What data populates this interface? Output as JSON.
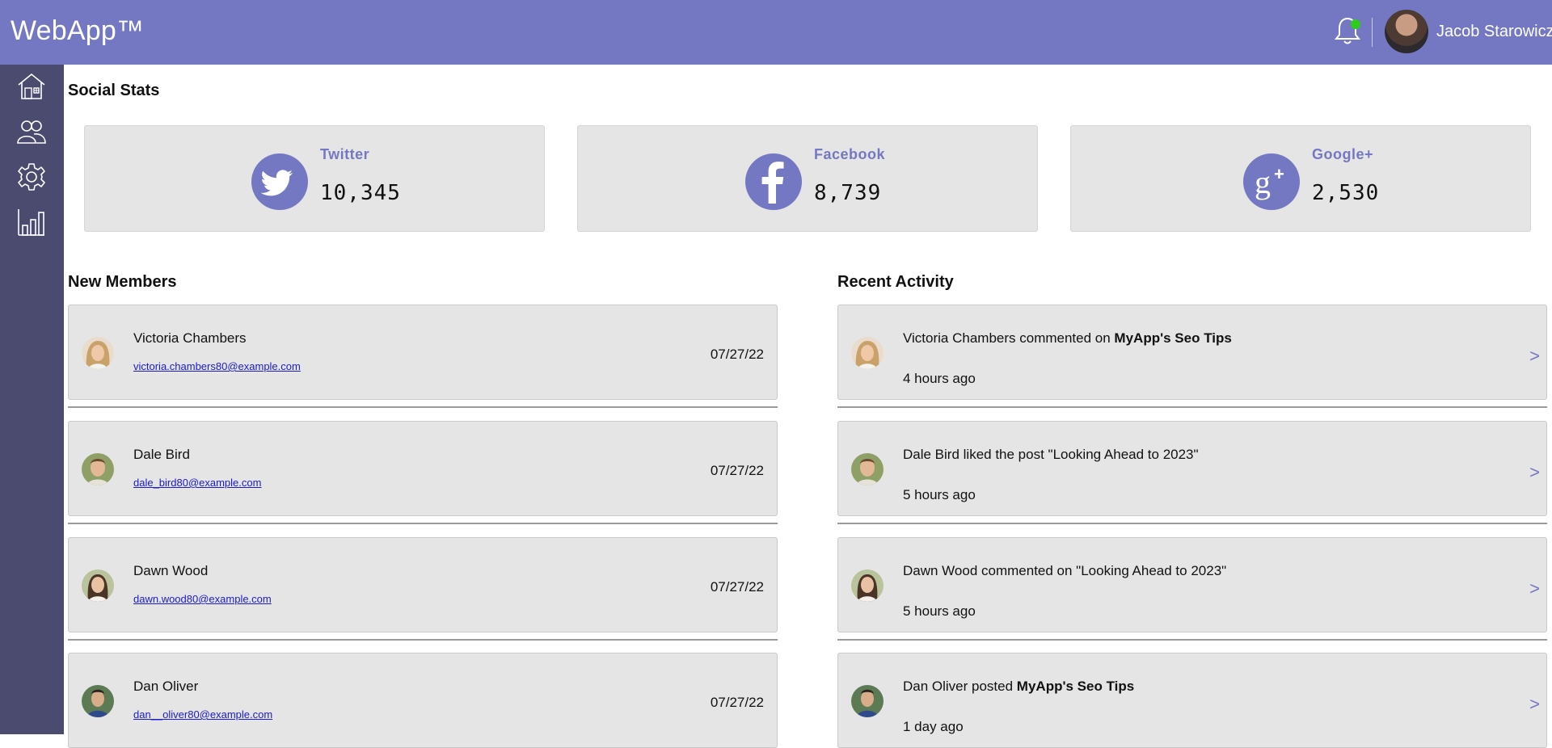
{
  "app": {
    "brand": "WebApp™"
  },
  "header": {
    "user_name": "Jacob Starowicz"
  },
  "sections": {
    "social_stats": "Social Stats",
    "new_members": "New Members",
    "recent_activity": "Recent Activity"
  },
  "stats": [
    {
      "label": "Twitter",
      "value": "10,345",
      "icon": "twitter-icon"
    },
    {
      "label": "Facebook",
      "value": "8,739",
      "icon": "facebook-icon"
    },
    {
      "label": "Google+",
      "value": "2,530",
      "icon": "google-plus-icon"
    }
  ],
  "members": [
    {
      "name": "Victoria Chambers",
      "email": "victoria.chambers80@example.com",
      "date": "07/27/22"
    },
    {
      "name": "Dale Bird",
      "email": "dale_bird80@example.com",
      "date": "07/27/22"
    },
    {
      "name": "Dawn Wood",
      "email": "dawn.wood80@example.com",
      "date": "07/27/22"
    },
    {
      "name": "Dan Oliver",
      "email": "dan__oliver80@example.com",
      "date": "07/27/22"
    }
  ],
  "activity": [
    {
      "prefix": "Victoria Chambers commented on ",
      "emph": "MyApp's Seo Tips",
      "time": "4 hours ago"
    },
    {
      "prefix": "Dale Bird liked the post \"Looking Ahead to 2023\"",
      "emph": "",
      "time": "5 hours ago"
    },
    {
      "prefix": "Dawn Wood commented on \"Looking Ahead to 2023\"",
      "emph": "",
      "time": "5 hours ago"
    },
    {
      "prefix": "Dan Oliver posted ",
      "emph": "MyApp's Seo Tips",
      "time": "1 day ago"
    }
  ],
  "arrow": ">",
  "colors": {
    "accent": "#7478c2",
    "sidebar": "#4b4b70",
    "card": "#e5e5e5",
    "online": "#2ecc1a",
    "link": "#1a1ad0"
  }
}
